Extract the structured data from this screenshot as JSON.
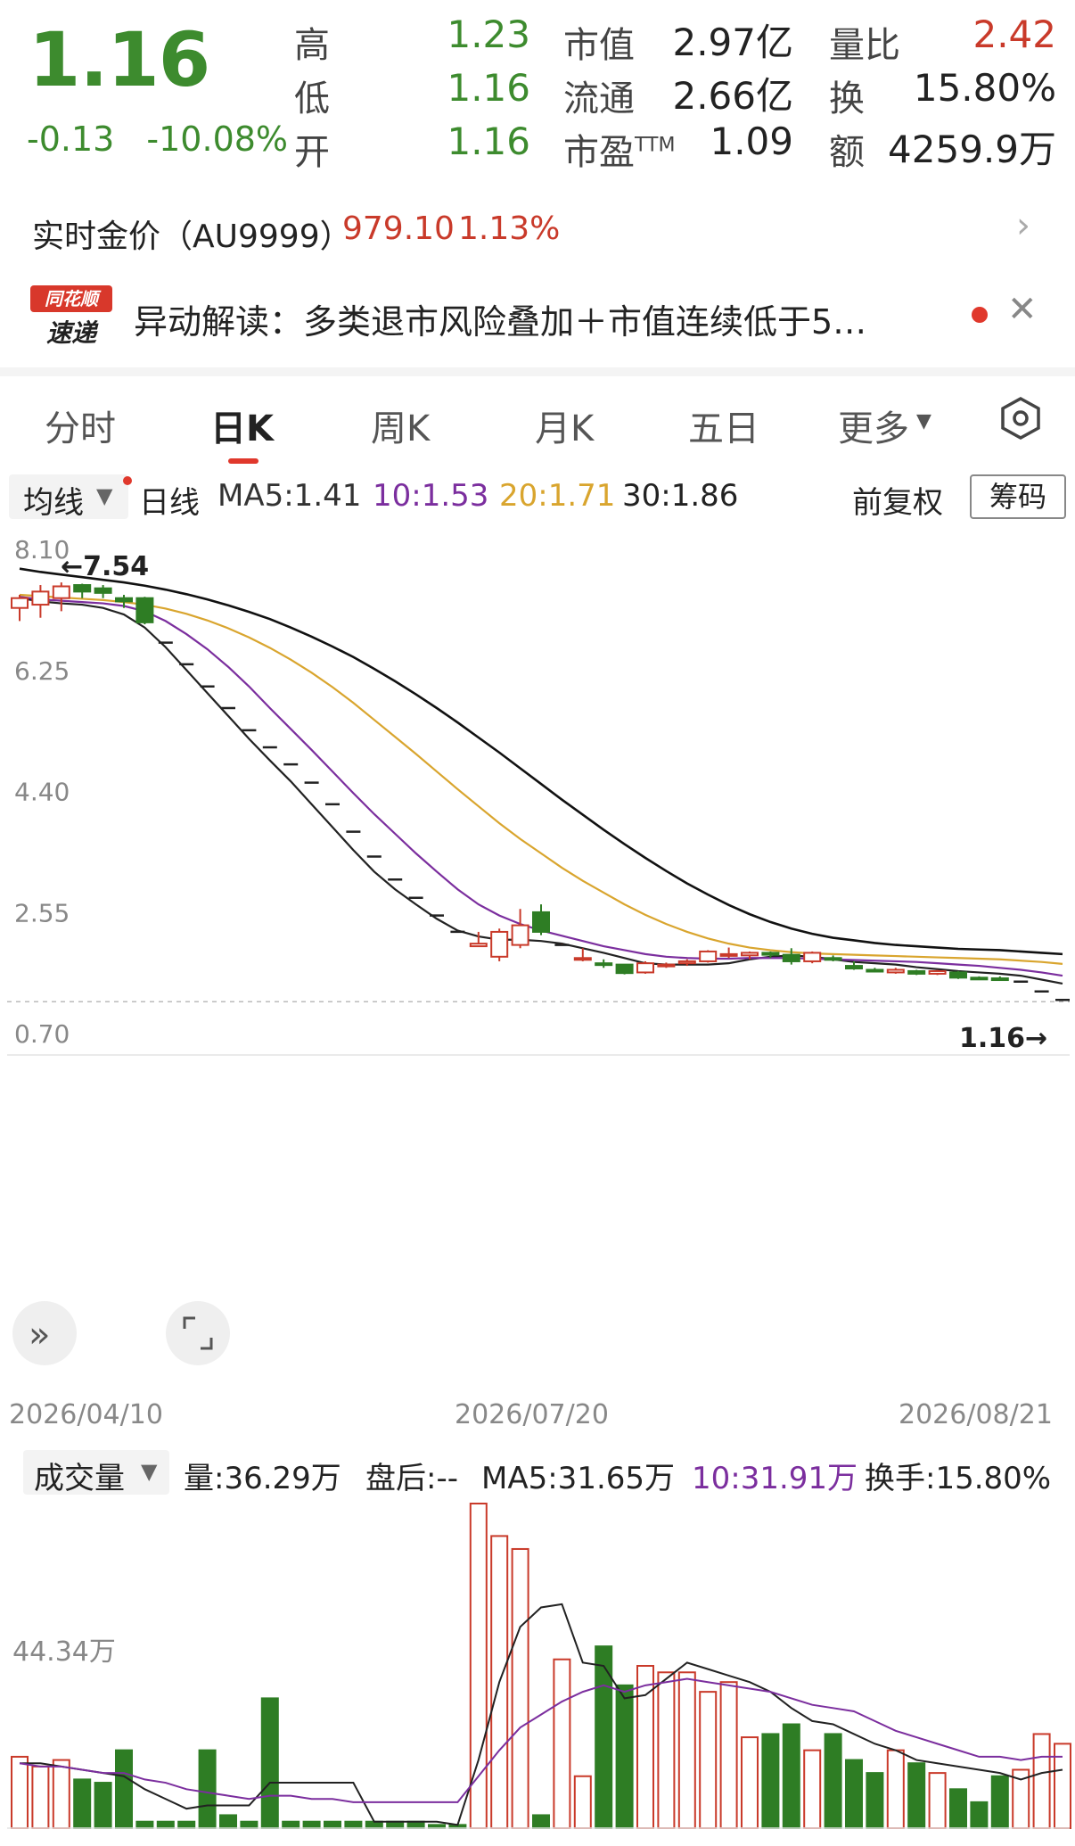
{
  "quote": {
    "price": "1.16",
    "change": "-0.13",
    "change_pct": "-10.08%",
    "rows": [
      [
        {
          "label": "高",
          "value": "1.23",
          "color": "green"
        },
        {
          "label": "市值",
          "value": "2.97亿",
          "color": "dark"
        },
        {
          "label": "量比",
          "value": "2.42",
          "color": "red"
        }
      ],
      [
        {
          "label": "低",
          "value": "1.16",
          "color": "green"
        },
        {
          "label": "流通",
          "value": "2.66亿",
          "color": "dark"
        },
        {
          "label": "换",
          "value": "15.80%",
          "color": "dark"
        }
      ],
      [
        {
          "label": "开",
          "value": "1.16",
          "color": "green"
        },
        {
          "label": "市盈TTM",
          "value": "1.09",
          "color": "dark"
        },
        {
          "label": "额",
          "value": "4259.9万",
          "color": "dark"
        }
      ]
    ]
  },
  "gold": {
    "label": "实时金价（AU9999）",
    "price": "979.10",
    "pct": "1.13%"
  },
  "news": {
    "badge_top": "同花顺",
    "badge_bottom": "速递",
    "text": "异动解读：多类退市风险叠加＋市值连续低于5…"
  },
  "tabs": [
    "分时",
    "日K",
    "周K",
    "月K",
    "五日",
    "更多"
  ],
  "active_tab": 1,
  "ma_bar": {
    "selector": "均线",
    "period": "日线",
    "ma5": "MA5:1.41",
    "ma10": "10:1.53",
    "ma20": "20:1.71",
    "ma30": "30:1.86",
    "adjust": "前复权",
    "chips": "筹码"
  },
  "colors": {
    "up": "#c93a2a",
    "down": "#2e7d24",
    "ma5": "#222222",
    "ma10": "#7b2e9e",
    "ma20": "#d9a52e",
    "ma30": "#111111",
    "accent": "#e0382c"
  },
  "price_axis": {
    "ticks": [
      "8.10",
      "6.25",
      "4.40",
      "2.55",
      "0.70"
    ],
    "high_label": "←7.54",
    "last_label": "1.16→"
  },
  "date_axis": [
    "2026/04/10",
    "2026/07/20",
    "2026/08/21"
  ],
  "volume_bar": {
    "selector": "成交量",
    "vol": "量:36.29万",
    "after": "盘后:--",
    "ma5": "MA5:31.65万",
    "ma10": "10:31.91万",
    "turnover": "换手:15.80%"
  },
  "volume_axis": {
    "label": "44.34万"
  },
  "chart_data": {
    "type": "candlestick",
    "ylim": [
      0.7,
      8.1
    ],
    "candles": [
      {
        "o": 7.15,
        "h": 7.35,
        "l": 6.95,
        "c": 7.3
      },
      {
        "o": 7.2,
        "h": 7.5,
        "l": 7.0,
        "c": 7.4
      },
      {
        "o": 7.3,
        "h": 7.54,
        "l": 7.1,
        "c": 7.48
      },
      {
        "o": 7.5,
        "h": 7.52,
        "l": 7.3,
        "c": 7.4
      },
      {
        "o": 7.45,
        "h": 7.5,
        "l": 7.3,
        "c": 7.38
      },
      {
        "o": 7.3,
        "h": 7.35,
        "l": 7.15,
        "c": 7.25
      },
      {
        "o": 7.3,
        "h": 7.32,
        "l": 6.9,
        "c": 6.93
      },
      {
        "o": 6.62,
        "h": 6.62,
        "l": 6.62,
        "c": 6.62
      },
      {
        "o": 6.29,
        "h": 6.29,
        "l": 6.29,
        "c": 6.29
      },
      {
        "o": 5.95,
        "h": 5.95,
        "l": 5.95,
        "c": 5.95
      },
      {
        "o": 5.62,
        "h": 5.62,
        "l": 5.62,
        "c": 5.62
      },
      {
        "o": 5.28,
        "h": 5.28,
        "l": 5.28,
        "c": 5.28
      },
      {
        "o": 5.02,
        "h": 5.02,
        "l": 5.02,
        "c": 5.02
      },
      {
        "o": 4.76,
        "h": 4.76,
        "l": 4.76,
        "c": 4.76
      },
      {
        "o": 4.48,
        "h": 4.48,
        "l": 4.48,
        "c": 4.48
      },
      {
        "o": 4.15,
        "h": 4.15,
        "l": 4.15,
        "c": 4.15
      },
      {
        "o": 3.73,
        "h": 3.73,
        "l": 3.73,
        "c": 3.73
      },
      {
        "o": 3.35,
        "h": 3.35,
        "l": 3.35,
        "c": 3.35
      },
      {
        "o": 3.0,
        "h": 3.0,
        "l": 3.0,
        "c": 3.0
      },
      {
        "o": 2.72,
        "h": 2.72,
        "l": 2.72,
        "c": 2.72
      },
      {
        "o": 2.45,
        "h": 2.45,
        "l": 2.45,
        "c": 2.45
      },
      {
        "o": 2.2,
        "h": 2.2,
        "l": 2.2,
        "c": 2.2
      },
      {
        "o": 1.98,
        "h": 2.2,
        "l": 1.98,
        "c": 2.02
      },
      {
        "o": 1.82,
        "h": 2.25,
        "l": 1.75,
        "c": 2.2
      },
      {
        "o": 2.0,
        "h": 2.55,
        "l": 1.95,
        "c": 2.3
      },
      {
        "o": 2.5,
        "h": 2.62,
        "l": 2.15,
        "c": 2.2
      },
      {
        "o": 2.0,
        "h": 2.02,
        "l": 2.0,
        "c": 2.0
      },
      {
        "o": 1.78,
        "h": 1.95,
        "l": 1.75,
        "c": 1.8
      },
      {
        "o": 1.72,
        "h": 1.78,
        "l": 1.65,
        "c": 1.7
      },
      {
        "o": 1.7,
        "h": 1.7,
        "l": 1.55,
        "c": 1.57
      },
      {
        "o": 1.58,
        "h": 1.75,
        "l": 1.56,
        "c": 1.72
      },
      {
        "o": 1.68,
        "h": 1.73,
        "l": 1.65,
        "c": 1.7
      },
      {
        "o": 1.72,
        "h": 1.78,
        "l": 1.68,
        "c": 1.75
      },
      {
        "o": 1.75,
        "h": 1.92,
        "l": 1.73,
        "c": 1.9
      },
      {
        "o": 1.85,
        "h": 1.96,
        "l": 1.8,
        "c": 1.86
      },
      {
        "o": 1.84,
        "h": 1.9,
        "l": 1.78,
        "c": 1.88
      },
      {
        "o": 1.88,
        "h": 1.9,
        "l": 1.8,
        "c": 1.85
      },
      {
        "o": 1.85,
        "h": 1.95,
        "l": 1.7,
        "c": 1.75
      },
      {
        "o": 1.75,
        "h": 1.9,
        "l": 1.72,
        "c": 1.88
      },
      {
        "o": 1.8,
        "h": 1.84,
        "l": 1.75,
        "c": 1.78
      },
      {
        "o": 1.68,
        "h": 1.75,
        "l": 1.62,
        "c": 1.64
      },
      {
        "o": 1.62,
        "h": 1.65,
        "l": 1.58,
        "c": 1.6
      },
      {
        "o": 1.58,
        "h": 1.65,
        "l": 1.56,
        "c": 1.62
      },
      {
        "o": 1.6,
        "h": 1.62,
        "l": 1.54,
        "c": 1.56
      },
      {
        "o": 1.56,
        "h": 1.62,
        "l": 1.54,
        "c": 1.6
      },
      {
        "o": 1.58,
        "h": 1.6,
        "l": 1.48,
        "c": 1.5
      },
      {
        "o": 1.5,
        "h": 1.52,
        "l": 1.47,
        "c": 1.49
      },
      {
        "o": 1.49,
        "h": 1.52,
        "l": 1.45,
        "c": 1.47
      },
      {
        "o": 1.44,
        "h": 1.44,
        "l": 1.44,
        "c": 1.44
      },
      {
        "o": 1.29,
        "h": 1.29,
        "l": 1.29,
        "c": 1.29
      },
      {
        "o": 1.16,
        "h": 1.16,
        "l": 1.16,
        "c": 1.16
      }
    ],
    "ma_series": [
      {
        "name": "MA5",
        "color": "ma5",
        "values": [
          7.3,
          7.25,
          7.22,
          7.2,
          7.15,
          7.05,
          6.85,
          6.55,
          6.2,
          5.85,
          5.5,
          5.15,
          4.82,
          4.5,
          4.15,
          3.8,
          3.45,
          3.12,
          2.85,
          2.62,
          2.4,
          2.22,
          2.13,
          2.08,
          2.08,
          2.06,
          2.02,
          1.95,
          1.88,
          1.8,
          1.72,
          1.7,
          1.7,
          1.7,
          1.72,
          1.78,
          1.82,
          1.84,
          1.82,
          1.78,
          1.74,
          1.72,
          1.7,
          1.66,
          1.63,
          1.6,
          1.58,
          1.56,
          1.53,
          1.47,
          1.41
        ]
      },
      {
        "name": "10",
        "color": "ma10",
        "values": [
          7.32,
          7.28,
          7.26,
          7.24,
          7.22,
          7.18,
          7.1,
          6.95,
          6.75,
          6.52,
          6.25,
          5.95,
          5.62,
          5.3,
          4.98,
          4.65,
          4.32,
          4.0,
          3.7,
          3.4,
          3.12,
          2.85,
          2.62,
          2.45,
          2.32,
          2.22,
          2.14,
          2.06,
          1.98,
          1.92,
          1.86,
          1.82,
          1.8,
          1.79,
          1.79,
          1.8,
          1.8,
          1.8,
          1.79,
          1.78,
          1.77,
          1.76,
          1.75,
          1.74,
          1.72,
          1.7,
          1.68,
          1.65,
          1.62,
          1.58,
          1.53
        ]
      },
      {
        "name": "20",
        "color": "ma20",
        "values": [
          7.35,
          7.33,
          7.31,
          7.29,
          7.27,
          7.24,
          7.2,
          7.14,
          7.06,
          6.96,
          6.84,
          6.7,
          6.54,
          6.36,
          6.16,
          5.94,
          5.7,
          5.44,
          5.18,
          4.92,
          4.65,
          4.38,
          4.12,
          3.86,
          3.62,
          3.4,
          3.18,
          2.98,
          2.8,
          2.62,
          2.46,
          2.32,
          2.2,
          2.1,
          2.02,
          1.96,
          1.92,
          1.89,
          1.87,
          1.86,
          1.85,
          1.84,
          1.83,
          1.82,
          1.81,
          1.8,
          1.79,
          1.78,
          1.76,
          1.74,
          1.71
        ]
      },
      {
        "name": "30",
        "color": "ma30",
        "values": [
          7.75,
          7.7,
          7.66,
          7.62,
          7.58,
          7.54,
          7.49,
          7.43,
          7.36,
          7.28,
          7.19,
          7.09,
          6.98,
          6.85,
          6.71,
          6.56,
          6.4,
          6.22,
          6.03,
          5.83,
          5.62,
          5.4,
          5.17,
          4.94,
          4.7,
          4.46,
          4.22,
          3.99,
          3.76,
          3.54,
          3.33,
          3.13,
          2.94,
          2.77,
          2.61,
          2.47,
          2.35,
          2.25,
          2.17,
          2.11,
          2.07,
          2.03,
          2.0,
          1.98,
          1.96,
          1.94,
          1.93,
          1.92,
          1.9,
          1.88,
          1.86
        ]
      }
    ],
    "volume": {
      "ylim": [
        0,
        100
      ],
      "bars": [
        22,
        19,
        21,
        15,
        14,
        24,
        2,
        2,
        2,
        24,
        4,
        2,
        40,
        2,
        2,
        2,
        2,
        2,
        2,
        2,
        1,
        1,
        100,
        90,
        86,
        4,
        52,
        16,
        56,
        44,
        50,
        48,
        48,
        42,
        45,
        28,
        29,
        32,
        24,
        29,
        21,
        17,
        24,
        20,
        17,
        12,
        8,
        16,
        18,
        29,
        26
      ],
      "ma5": [
        20,
        20,
        19,
        18,
        17,
        16,
        12,
        9,
        6,
        7,
        7,
        7,
        14,
        14,
        14,
        14,
        14,
        2,
        2,
        2,
        2,
        1,
        21,
        45,
        62,
        68,
        69,
        51,
        50,
        40,
        41,
        46,
        51,
        49,
        47,
        45,
        42,
        37,
        33,
        32,
        29,
        26,
        24,
        21,
        20,
        19,
        18,
        17,
        15,
        17,
        18
      ],
      "ma10": [
        20,
        19,
        19,
        18,
        17,
        17,
        15,
        14,
        12,
        11,
        10,
        9,
        10,
        10,
        9,
        9,
        8,
        8,
        8,
        8,
        8,
        8,
        16,
        24,
        31,
        35,
        39,
        42,
        44,
        42,
        44,
        45,
        46,
        45,
        44,
        43,
        42,
        40,
        38,
        37,
        36,
        33,
        30,
        28,
        26,
        24,
        22,
        22,
        21,
        22,
        22
      ]
    }
  }
}
